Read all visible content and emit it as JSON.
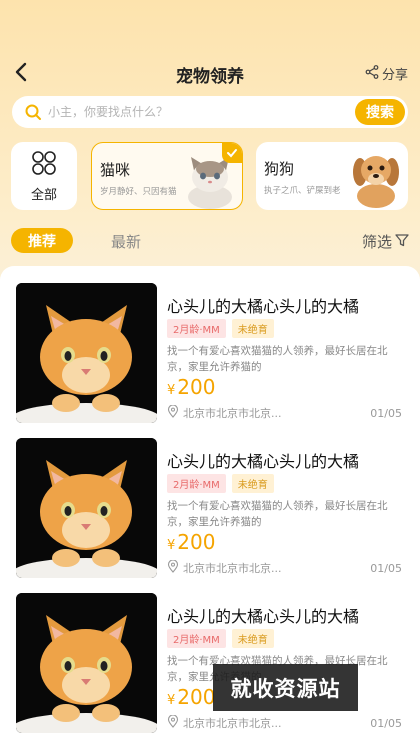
{
  "header": {
    "title": "宠物领养",
    "share_label": "分享"
  },
  "search": {
    "placeholder": "小主，你要找点什么？",
    "button_label": "搜索"
  },
  "categories": {
    "all_label": "全部",
    "cat": {
      "name": "猫咪",
      "desc": "岁月静好、只因有猫"
    },
    "dog": {
      "name": "狗狗",
      "desc": "执子之爪、铲屎到老"
    }
  },
  "tabs": {
    "recommend": "推荐",
    "latest": "最新",
    "filter": "筛选"
  },
  "listings": [
    {
      "title": "心头儿的大橘心头儿的大橘",
      "age": "2月龄·MM",
      "status": "未绝育",
      "desc": "找一个有爱心喜欢猫猫的人领养，最好长居在北京，家里允许养猫的",
      "currency": "¥",
      "price": "200",
      "location": "北京市北京市北京...",
      "date": "01/05"
    },
    {
      "title": "心头儿的大橘心头儿的大橘",
      "age": "2月龄·MM",
      "status": "未绝育",
      "desc": "找一个有爱心喜欢猫猫的人领养，最好长居在北京，家里允许养猫的",
      "currency": "¥",
      "price": "200",
      "location": "北京市北京市北京...",
      "date": "01/05"
    },
    {
      "title": "心头儿的大橘心头儿的大橘",
      "age": "2月龄·MM",
      "status": "未绝育",
      "desc": "找一个有爱心喜欢猫猫的人领养，最好长居在北京，家里允许养猫的",
      "currency": "¥",
      "price": "200",
      "location": "北京市北京市北京...",
      "date": "01/05"
    }
  ],
  "watermark": "就收资源站",
  "colors": {
    "accent": "#f5b400",
    "price": "#f5a400",
    "tag_age_bg": "#fde4e4",
    "tag_status_bg": "#fff1d4"
  }
}
